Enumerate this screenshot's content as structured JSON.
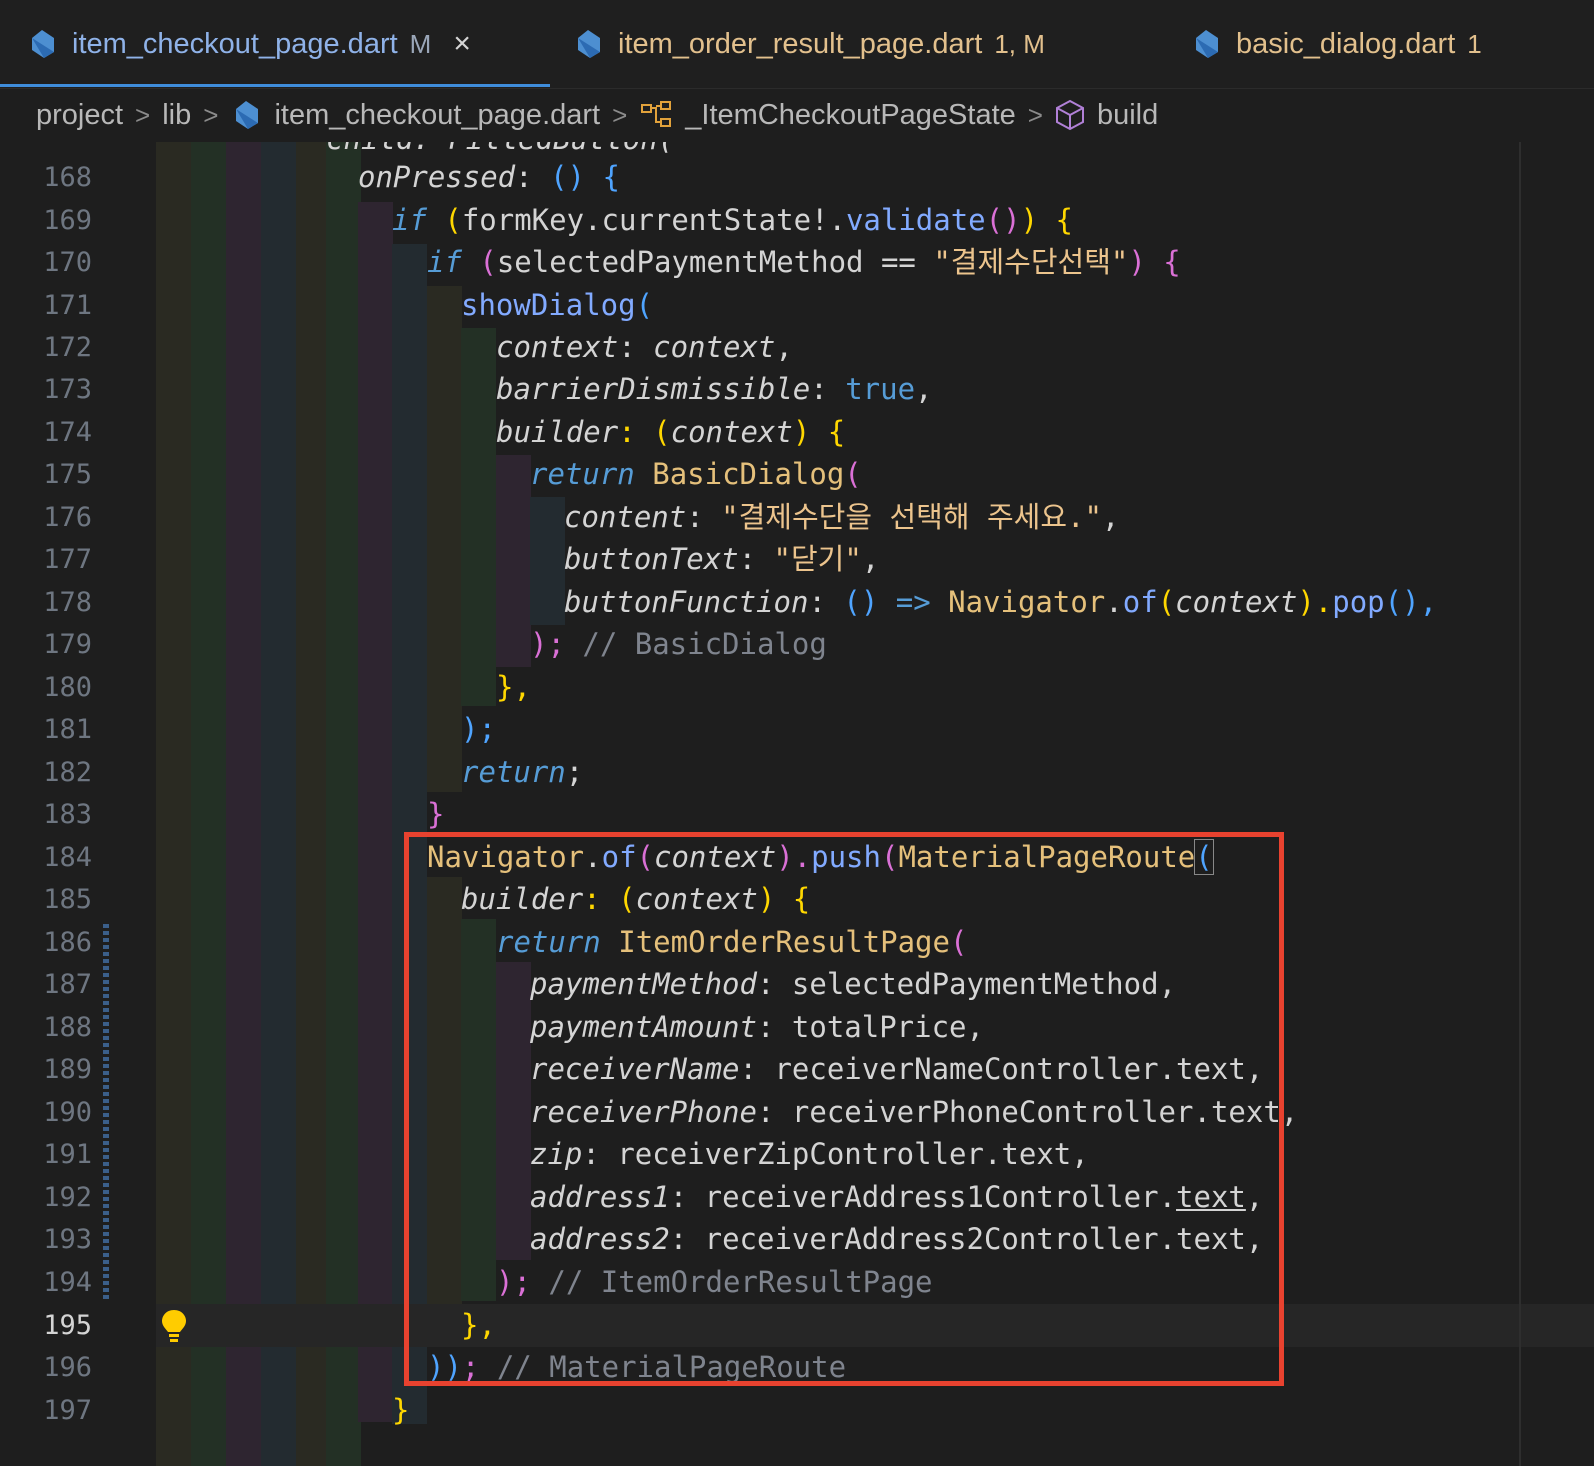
{
  "tabs": [
    {
      "name": "item_checkout_page.dart",
      "badge": "M",
      "close": "×"
    },
    {
      "name": "item_order_result_page.dart",
      "badge": "1, M"
    },
    {
      "name": "basic_dialog.dart",
      "badge": "1"
    }
  ],
  "breadcrumb": {
    "items": [
      "project",
      "lib",
      "item_checkout_page.dart",
      "_ItemCheckoutPageState",
      "build"
    ],
    "separator": ">"
  },
  "editor": {
    "partial_top_line": "child: FilledButton(",
    "line_numbers": [
      "168",
      "169",
      "170",
      "171",
      "172",
      "173",
      "174",
      "175",
      "176",
      "177",
      "178",
      "179",
      "180",
      "181",
      "182",
      "183",
      "184",
      "185",
      "186",
      "187",
      "188",
      "189",
      "190",
      "191",
      "192",
      "193",
      "194",
      "195",
      "196",
      "197"
    ],
    "current_line": "195",
    "lines": {
      "l168": {
        "a": "onPressed",
        "b": ": ",
        "c": "()",
        "d": " {"
      },
      "l169": {
        "a": "if",
        "b": " (",
        "c": "formKey",
        "d": ".currentState!.",
        "e": "validate",
        "f": "()",
        "g": ") {"
      },
      "l170": {
        "a": "if",
        "b": " (",
        "c": "selectedPaymentMethod",
        "d": " == ",
        "e": "\"결제수단선택\"",
        "f": ") {"
      },
      "l171": {
        "a": "showDialog",
        "b": "("
      },
      "l172": {
        "a": "context",
        "b": ": ",
        "c": "context",
        "d": ","
      },
      "l173": {
        "a": "barrierDismissible",
        "b": ": ",
        "c": "true",
        "d": ","
      },
      "l174": {
        "a": "builder",
        "b": ": (",
        "c": "context",
        "d": ") {"
      },
      "l175": {
        "a": "return",
        "b": " ",
        "c": "BasicDialog",
        "d": "("
      },
      "l176": {
        "a": "content",
        "b": ": ",
        "c": "\"결제수단을 선택해 주세요.\"",
        "d": ","
      },
      "l177": {
        "a": "buttonText",
        "b": ": ",
        "c": "\"닫기\"",
        "d": ","
      },
      "l178": {
        "a": "buttonFunction",
        "b": ": ",
        "c": "()",
        "d": " => ",
        "e": "Navigator",
        "f": ".",
        "g": "of",
        "h": "(",
        "i": "context",
        "j": ").",
        "k": "pop",
        "l": "(),"
      },
      "l179": {
        "a": ");",
        "b": " // BasicDialog"
      },
      "l180": {
        "a": "},"
      },
      "l181": {
        "a": ");"
      },
      "l182": {
        "a": "return",
        "b": ";"
      },
      "l183": {
        "a": "}"
      },
      "l184": {
        "a": "Navigator",
        "b": ".",
        "c": "of",
        "d": "(",
        "e": "context",
        "f": ").",
        "g": "push",
        "h": "(",
        "i": "MaterialPageRoute",
        "j": "("
      },
      "l185": {
        "a": "builder",
        "b": ": (",
        "c": "context",
        "d": ") {"
      },
      "l186": {
        "a": "return",
        "b": " ",
        "c": "ItemOrderResultPage",
        "d": "("
      },
      "l187": {
        "a": "paymentMethod",
        "b": ": ",
        "c": "selectedPaymentMethod",
        "d": ","
      },
      "l188": {
        "a": "paymentAmount",
        "b": ": ",
        "c": "totalPrice",
        "d": ","
      },
      "l189": {
        "a": "receiverName",
        "b": ": ",
        "c": "receiverNameController",
        "d": ".text,"
      },
      "l190": {
        "a": "receiverPhone",
        "b": ": ",
        "c": "receiverPhoneController",
        "d": ".text,"
      },
      "l191": {
        "a": "zip",
        "b": ": ",
        "c": "receiverZipController",
        "d": ".text,"
      },
      "l192": {
        "a": "address1",
        "b": ": ",
        "c": "receiverAddress1Controller",
        "d": ".",
        "e": "text",
        "f": ","
      },
      "l193": {
        "a": "address2",
        "b": ": ",
        "c": "receiverAddress2Controller",
        "d": ".text,"
      },
      "l194": {
        "a": ");",
        "b": " // ItemOrderResultPage"
      },
      "l195": {
        "a": "},"
      },
      "l196": {
        "a": "))",
        "b": ";",
        "c": " // MaterialPageRoute"
      },
      "l197": {
        "a": "}"
      }
    }
  },
  "colors": {
    "highlight_box": "#e8422f",
    "active_tab_underline": "#3f8ddb",
    "modified_tab_text": "#e2c08d"
  },
  "icons": [
    "dart-file-icon",
    "close-icon",
    "chevron-right-icon",
    "symbol-class-icon",
    "symbol-method-icon",
    "lightbulb-icon"
  ]
}
